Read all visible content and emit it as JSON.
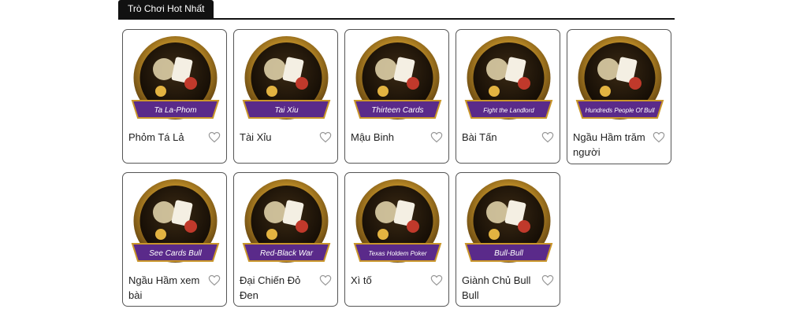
{
  "section": {
    "title": "Trò Chơi Hot Nhất"
  },
  "colors": {
    "gold": "#c9962a",
    "purple_band": "#5a2a8a",
    "tab_bg": "#111111"
  },
  "games": [
    {
      "name": "Phỏm Tá Lả",
      "banner": "Ta La-Phom",
      "icon": "ta-la-phom-art"
    },
    {
      "name": "Tài Xỉu",
      "banner": "Tai Xiu",
      "icon": "tai-xiu-art"
    },
    {
      "name": "Mậu Binh",
      "banner": "Thirteen Cards",
      "icon": "thirteen-cards-art"
    },
    {
      "name": "Bài Tấn",
      "banner": "Fight the Landlord",
      "icon": "landlord-art"
    },
    {
      "name": "Ngầu Hầm trăm người",
      "banner": "Hundreds People Of Bull",
      "icon": "bull-hat-art"
    },
    {
      "name": "Ngầu Hầm xem bài",
      "banner": "See Cards Bull",
      "icon": "see-cards-bull-art"
    },
    {
      "name": "Đại Chiến Đỏ Đen",
      "banner": "Red-Black War",
      "icon": "red-black-war-art"
    },
    {
      "name": "Xì tố",
      "banner": "Texas Holdem Poker",
      "icon": "texas-holdem-art"
    },
    {
      "name": "Giành Chủ Bull Bull",
      "banner": "Bull-Bull",
      "icon": "bull-bull-art"
    }
  ]
}
